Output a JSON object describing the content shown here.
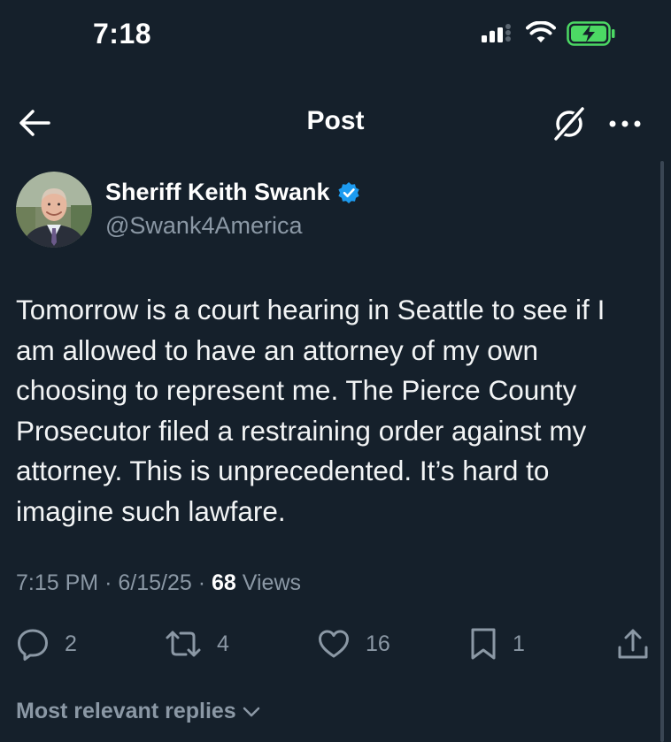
{
  "status_bar": {
    "time": "7:18",
    "icons": [
      "cellular-signal-icon",
      "wifi-icon",
      "battery-charging-icon"
    ],
    "battery_color": "#4cd964"
  },
  "nav": {
    "title": "Post",
    "icons": [
      "back-arrow-icon",
      "grok-icon",
      "more-icon"
    ]
  },
  "tweet": {
    "author_name": "Sheriff Keith Swank",
    "handle": "@Swank4America",
    "verified": true,
    "verified_color": "#1d9bf0",
    "text": "Tomorrow is a court hearing in Seattle to see if I am allowed to have an attorney of my own choosing to represent me. The Pierce County Prosecutor filed a restraining order against my attorney. This is unprecedented. It’s hard to imagine such lawfare.",
    "time": "7:15 PM",
    "date": "6/15/25",
    "separator": "·",
    "views_count": "68",
    "views_label": "Views"
  },
  "actions": {
    "replies": "2",
    "reposts": "4",
    "likes": "16",
    "bookmarks": "1"
  },
  "replies_sort": {
    "label": "Most relevant replies"
  },
  "colors": {
    "background": "#15202b",
    "text": "#e7e9ea",
    "muted": "#8b98a5",
    "accent": "#1d9bf0"
  }
}
